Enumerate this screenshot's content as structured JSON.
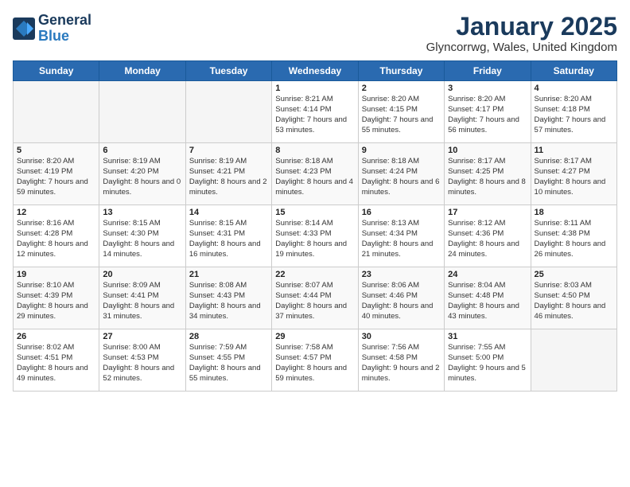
{
  "logo": {
    "general": "General",
    "blue": "Blue"
  },
  "header": {
    "month": "January 2025",
    "location": "Glyncorrwg, Wales, United Kingdom"
  },
  "weekdays": [
    "Sunday",
    "Monday",
    "Tuesday",
    "Wednesday",
    "Thursday",
    "Friday",
    "Saturday"
  ],
  "weeks": [
    [
      {
        "day": "",
        "sunrise": "",
        "sunset": "",
        "daylight": ""
      },
      {
        "day": "",
        "sunrise": "",
        "sunset": "",
        "daylight": ""
      },
      {
        "day": "",
        "sunrise": "",
        "sunset": "",
        "daylight": ""
      },
      {
        "day": "1",
        "sunrise": "Sunrise: 8:21 AM",
        "sunset": "Sunset: 4:14 PM",
        "daylight": "Daylight: 7 hours and 53 minutes."
      },
      {
        "day": "2",
        "sunrise": "Sunrise: 8:20 AM",
        "sunset": "Sunset: 4:15 PM",
        "daylight": "Daylight: 7 hours and 55 minutes."
      },
      {
        "day": "3",
        "sunrise": "Sunrise: 8:20 AM",
        "sunset": "Sunset: 4:17 PM",
        "daylight": "Daylight: 7 hours and 56 minutes."
      },
      {
        "day": "4",
        "sunrise": "Sunrise: 8:20 AM",
        "sunset": "Sunset: 4:18 PM",
        "daylight": "Daylight: 7 hours and 57 minutes."
      }
    ],
    [
      {
        "day": "5",
        "sunrise": "Sunrise: 8:20 AM",
        "sunset": "Sunset: 4:19 PM",
        "daylight": "Daylight: 7 hours and 59 minutes."
      },
      {
        "day": "6",
        "sunrise": "Sunrise: 8:19 AM",
        "sunset": "Sunset: 4:20 PM",
        "daylight": "Daylight: 8 hours and 0 minutes."
      },
      {
        "day": "7",
        "sunrise": "Sunrise: 8:19 AM",
        "sunset": "Sunset: 4:21 PM",
        "daylight": "Daylight: 8 hours and 2 minutes."
      },
      {
        "day": "8",
        "sunrise": "Sunrise: 8:18 AM",
        "sunset": "Sunset: 4:23 PM",
        "daylight": "Daylight: 8 hours and 4 minutes."
      },
      {
        "day": "9",
        "sunrise": "Sunrise: 8:18 AM",
        "sunset": "Sunset: 4:24 PM",
        "daylight": "Daylight: 8 hours and 6 minutes."
      },
      {
        "day": "10",
        "sunrise": "Sunrise: 8:17 AM",
        "sunset": "Sunset: 4:25 PM",
        "daylight": "Daylight: 8 hours and 8 minutes."
      },
      {
        "day": "11",
        "sunrise": "Sunrise: 8:17 AM",
        "sunset": "Sunset: 4:27 PM",
        "daylight": "Daylight: 8 hours and 10 minutes."
      }
    ],
    [
      {
        "day": "12",
        "sunrise": "Sunrise: 8:16 AM",
        "sunset": "Sunset: 4:28 PM",
        "daylight": "Daylight: 8 hours and 12 minutes."
      },
      {
        "day": "13",
        "sunrise": "Sunrise: 8:15 AM",
        "sunset": "Sunset: 4:30 PM",
        "daylight": "Daylight: 8 hours and 14 minutes."
      },
      {
        "day": "14",
        "sunrise": "Sunrise: 8:15 AM",
        "sunset": "Sunset: 4:31 PM",
        "daylight": "Daylight: 8 hours and 16 minutes."
      },
      {
        "day": "15",
        "sunrise": "Sunrise: 8:14 AM",
        "sunset": "Sunset: 4:33 PM",
        "daylight": "Daylight: 8 hours and 19 minutes."
      },
      {
        "day": "16",
        "sunrise": "Sunrise: 8:13 AM",
        "sunset": "Sunset: 4:34 PM",
        "daylight": "Daylight: 8 hours and 21 minutes."
      },
      {
        "day": "17",
        "sunrise": "Sunrise: 8:12 AM",
        "sunset": "Sunset: 4:36 PM",
        "daylight": "Daylight: 8 hours and 24 minutes."
      },
      {
        "day": "18",
        "sunrise": "Sunrise: 8:11 AM",
        "sunset": "Sunset: 4:38 PM",
        "daylight": "Daylight: 8 hours and 26 minutes."
      }
    ],
    [
      {
        "day": "19",
        "sunrise": "Sunrise: 8:10 AM",
        "sunset": "Sunset: 4:39 PM",
        "daylight": "Daylight: 8 hours and 29 minutes."
      },
      {
        "day": "20",
        "sunrise": "Sunrise: 8:09 AM",
        "sunset": "Sunset: 4:41 PM",
        "daylight": "Daylight: 8 hours and 31 minutes."
      },
      {
        "day": "21",
        "sunrise": "Sunrise: 8:08 AM",
        "sunset": "Sunset: 4:43 PM",
        "daylight": "Daylight: 8 hours and 34 minutes."
      },
      {
        "day": "22",
        "sunrise": "Sunrise: 8:07 AM",
        "sunset": "Sunset: 4:44 PM",
        "daylight": "Daylight: 8 hours and 37 minutes."
      },
      {
        "day": "23",
        "sunrise": "Sunrise: 8:06 AM",
        "sunset": "Sunset: 4:46 PM",
        "daylight": "Daylight: 8 hours and 40 minutes."
      },
      {
        "day": "24",
        "sunrise": "Sunrise: 8:04 AM",
        "sunset": "Sunset: 4:48 PM",
        "daylight": "Daylight: 8 hours and 43 minutes."
      },
      {
        "day": "25",
        "sunrise": "Sunrise: 8:03 AM",
        "sunset": "Sunset: 4:50 PM",
        "daylight": "Daylight: 8 hours and 46 minutes."
      }
    ],
    [
      {
        "day": "26",
        "sunrise": "Sunrise: 8:02 AM",
        "sunset": "Sunset: 4:51 PM",
        "daylight": "Daylight: 8 hours and 49 minutes."
      },
      {
        "day": "27",
        "sunrise": "Sunrise: 8:00 AM",
        "sunset": "Sunset: 4:53 PM",
        "daylight": "Daylight: 8 hours and 52 minutes."
      },
      {
        "day": "28",
        "sunrise": "Sunrise: 7:59 AM",
        "sunset": "Sunset: 4:55 PM",
        "daylight": "Daylight: 8 hours and 55 minutes."
      },
      {
        "day": "29",
        "sunrise": "Sunrise: 7:58 AM",
        "sunset": "Sunset: 4:57 PM",
        "daylight": "Daylight: 8 hours and 59 minutes."
      },
      {
        "day": "30",
        "sunrise": "Sunrise: 7:56 AM",
        "sunset": "Sunset: 4:58 PM",
        "daylight": "Daylight: 9 hours and 2 minutes."
      },
      {
        "day": "31",
        "sunrise": "Sunrise: 7:55 AM",
        "sunset": "Sunset: 5:00 PM",
        "daylight": "Daylight: 9 hours and 5 minutes."
      },
      {
        "day": "",
        "sunrise": "",
        "sunset": "",
        "daylight": ""
      }
    ]
  ]
}
